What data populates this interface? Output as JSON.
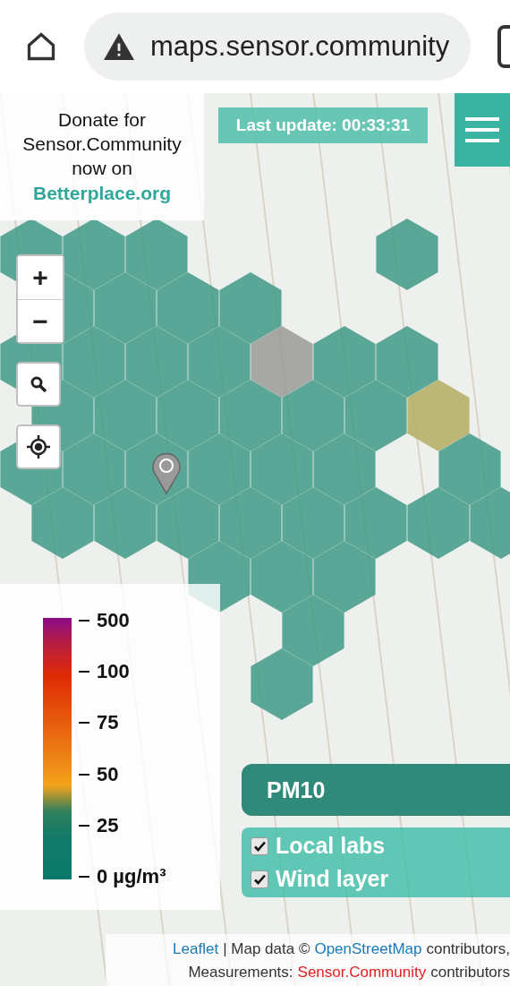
{
  "browser": {
    "url": "maps.sensor.community"
  },
  "donate": {
    "lines": [
      "Donate for",
      "Sensor.Community",
      "now on"
    ],
    "link": "Betterplace.org"
  },
  "last_update": "Last update: 00:33:31",
  "zoom": {
    "in": "+",
    "out": "−"
  },
  "legend": {
    "ticks": [
      "500",
      "100",
      "75",
      "50",
      "25",
      "0 µg/m³"
    ]
  },
  "pollutant": "PM10",
  "layers": [
    {
      "label": "Local labs",
      "checked": true
    },
    {
      "label": "Wind layer",
      "checked": true
    }
  ],
  "attribution": [
    [
      {
        "text": "Leaflet",
        "kind": "link"
      },
      {
        "text": "| Map data ©",
        "kind": "plain"
      },
      {
        "text": "OpenStreetMap",
        "kind": "link"
      },
      {
        "text": "contributors,",
        "kind": "plain"
      }
    ],
    [
      {
        "text": "Measurements:",
        "kind": "plain"
      },
      {
        "text": "Sensor.Community",
        "kind": "brand"
      },
      {
        "text": "contributors",
        "kind": "plain"
      }
    ]
  ]
}
